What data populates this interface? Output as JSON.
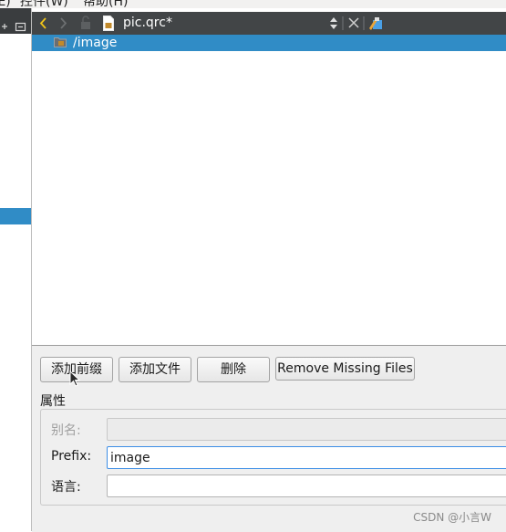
{
  "menubar": {
    "item_left_fragment": "辑(E)",
    "item_controls": "控件(W)",
    "item_help": "帮助(H)"
  },
  "editor": {
    "file_name": "pic.qrc*",
    "icons": [
      "back-icon",
      "forward-icon",
      "lock-icon",
      "qrc-file-icon",
      "up-down-arrows-icon",
      "close-icon",
      "split-icon"
    ]
  },
  "tree": {
    "items": [
      {
        "label": "/image",
        "icon": "folder-icon",
        "selected": true
      }
    ]
  },
  "buttons": {
    "add_prefix": "添加前缀",
    "add_files": "添加文件",
    "delete": "删除",
    "remove_missing": "Remove Missing Files"
  },
  "properties": {
    "title": "属性",
    "alias_label": "别名:",
    "alias_value": "",
    "prefix_label": "Prefix:",
    "prefix_value": "image",
    "language_label": "语言:",
    "language_value": ""
  },
  "watermark": "CSDN @小言W",
  "colors": {
    "selection": "#308cc6",
    "toolbar": "#424547",
    "panel": "#efefef",
    "active_border": "#3d8ee6"
  }
}
